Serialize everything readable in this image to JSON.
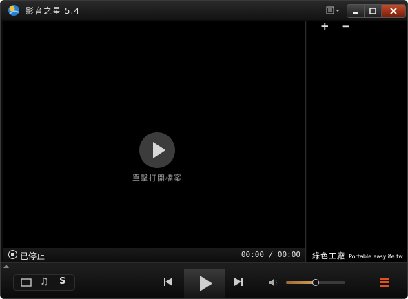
{
  "window": {
    "title": "影音之星 5.4"
  },
  "video": {
    "open_file_label": "單擊打開檔案"
  },
  "playlist": {
    "add_label": "+",
    "remove_label": "−",
    "watermark_cn": "綠色工廠",
    "watermark_en": "Portable.easylife.tw"
  },
  "status": {
    "state": "已停止",
    "time": "00:00 / 00:00"
  },
  "controls": {
    "subtitle_label": "S",
    "audio_mode_glyph": "♫",
    "volume_level": 0.5
  },
  "colors": {
    "close_button": "#c44a2a",
    "volume_accent": "#d79b55",
    "playlist_toggle": "#e0511e"
  }
}
